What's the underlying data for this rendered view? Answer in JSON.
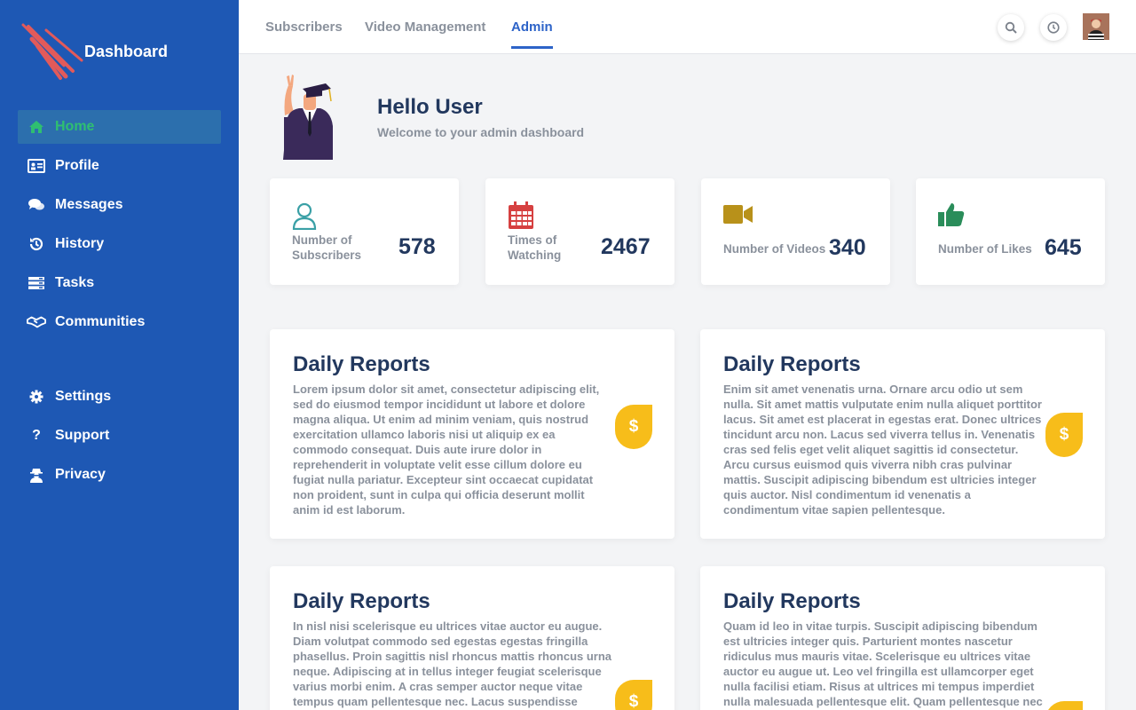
{
  "app": {
    "title": "Dashboard"
  },
  "sidebar": {
    "items": [
      {
        "label": "Home",
        "icon": "home-icon"
      },
      {
        "label": "Profile",
        "icon": "id-card-icon"
      },
      {
        "label": "Messages",
        "icon": "comments-icon"
      },
      {
        "label": "History",
        "icon": "history-icon"
      },
      {
        "label": "Tasks",
        "icon": "tasks-icon"
      },
      {
        "label": "Communities",
        "icon": "handshake-icon"
      }
    ],
    "bottom_items": [
      {
        "label": "Settings",
        "icon": "gear-icon"
      },
      {
        "label": "Support",
        "icon": "question-icon"
      },
      {
        "label": "Privacy",
        "icon": "user-secret-icon"
      }
    ],
    "active_item": "Home"
  },
  "header": {
    "tabs": [
      {
        "label": "Subscribers"
      },
      {
        "label": "Video Management"
      },
      {
        "label": "Admin"
      }
    ],
    "active_tab": "Admin",
    "icons": [
      "search-icon",
      "clock-icon",
      "avatar"
    ]
  },
  "hero": {
    "title": "Hello User",
    "subtitle": "Welcome to your admin dashboard"
  },
  "stats": [
    {
      "label": "Number of Subscribers",
      "label_line1": "Number of",
      "label_line2": "Subscribers",
      "value": "578",
      "icon": "user-icon",
      "color": "#3aa0a6"
    },
    {
      "label": "Times of Watching",
      "label_line1": "Times of",
      "label_line2": "Watching",
      "value": "2467",
      "icon": "calendar-icon",
      "color": "#d64040"
    },
    {
      "label": "Number of Videos",
      "value": "340",
      "icon": "video-camera-icon",
      "color": "#b8911a"
    },
    {
      "label": "Number of Likes",
      "value": "645",
      "icon": "thumbs-up-icon",
      "color": "#2a8d5a"
    }
  ],
  "reports": [
    {
      "title": "Daily Reports",
      "text": "Lorem ipsum dolor sit amet, consectetur adipiscing elit, sed do eiusmod tempor incididunt ut labore et dolore magna aliqua. Ut enim ad minim veniam, quis nostrud exercitation ullamco laboris nisi ut aliquip ex ea commodo consequat. Duis aute irure dolor in reprehenderit in voluptate velit esse cillum dolore eu fugiat nulla pariatur. Excepteur sint occaecat cupidatat non proident, sunt in culpa qui officia deserunt mollit anim id est laborum.",
      "badge": "$"
    },
    {
      "title": "Daily Reports",
      "text": "Enim sit amet venenatis urna. Ornare arcu odio ut sem nulla. Sit amet mattis vulputate enim nulla aliquet porttitor lacus. Sit amet est placerat in egestas erat. Donec ultrices tincidunt arcu non. Lacus sed viverra tellus in. Venenatis cras sed felis eget velit aliquet sagittis id consectetur. Arcu cursus euismod quis viverra nibh cras pulvinar mattis. Suscipit adipiscing bibendum est ultricies integer quis auctor. Nisl condimentum id venenatis a condimentum vitae sapien pellentesque.",
      "badge": "$"
    },
    {
      "title": "Daily Reports",
      "text": "In nisl nisi scelerisque eu ultrices vitae auctor eu augue. Diam volutpat commodo sed egestas egestas fringilla phasellus. Proin sagittis nisl rhoncus mattis rhoncus urna neque. Adipiscing at in tellus integer feugiat scelerisque varius morbi enim. A cras semper auctor neque vitae tempus quam pellentesque nec. Lacus suspendisse",
      "badge": "$"
    },
    {
      "title": "Daily Reports",
      "text": "Quam id leo in vitae turpis. Suscipit adipiscing bibendum est ultricies integer quis. Parturient montes nascetur ridiculus mus mauris vitae. Scelerisque eu ultrices vitae auctor eu augue ut. Leo vel fringilla est ullamcorper eget nulla facilisi etiam. Risus at ultrices mi tempus imperdiet nulla malesuada pellentesque elit. Quam pellentesque nec",
      "badge": "$"
    }
  ],
  "colors": {
    "sidebar": "#1e58b4",
    "accent": "#2d63c8",
    "active_nav": "#2fbf71",
    "coin": "#f7bd1a",
    "heading": "#22385e"
  }
}
